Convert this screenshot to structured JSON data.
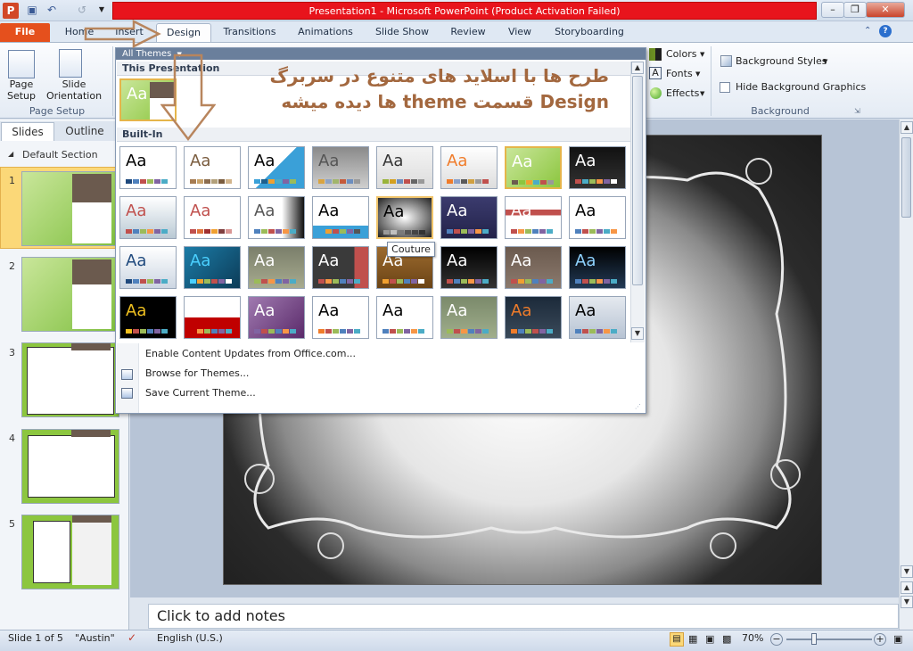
{
  "window": {
    "title": "Presentation1  -  Microsoft PowerPoint (Product Activation Failed)",
    "controls": [
      "–",
      "❐",
      "✕"
    ]
  },
  "tabs": [
    "Home",
    "Insert",
    "Design",
    "Transitions",
    "Animations",
    "Slide Show",
    "Review",
    "View",
    "Storyboarding"
  ],
  "file_tab": "File",
  "ribbon": {
    "page_setup": {
      "label": "Page\nSetup",
      "page_setup_1": "Page",
      "page_setup_2": "Setup",
      "orientation_1": "Slide",
      "orientation_2": "Orientation",
      "group": "Page Setup"
    },
    "theme_options": {
      "colors": "Colors",
      "fonts": "Fonts",
      "effects": "Effects"
    },
    "background": {
      "styles": "Background Styles",
      "hide": "Hide Background Graphics",
      "group": "Background"
    }
  },
  "themes_gallery": {
    "header": "All Themes",
    "this_presentation": "This Presentation",
    "built_in": "Built-In",
    "sample": "Aa",
    "tooltip": "Couture",
    "menu": [
      "Enable Content Updates from Office.com...",
      "Browse for Themes...",
      "Save Current Theme..."
    ]
  },
  "annotation": {
    "line1": "طرح ها با اسلاید های متنوع در سربرگ",
    "line2": "Design  قسمت theme ها دیده میشه"
  },
  "left_pane": {
    "tabs": [
      "Slides",
      "Outline"
    ],
    "section": "Default Section",
    "slide_numbers": [
      "1",
      "2",
      "3",
      "4",
      "5"
    ]
  },
  "notes": {
    "placeholder": "Click to add notes"
  },
  "status": {
    "slide": "Slide 1 of 5",
    "theme": "\"Austin\"",
    "language": "English (U.S.)",
    "zoom": "70%"
  },
  "colors": {
    "accent_file": "#e5501d",
    "title_red": "#e8141c",
    "annotation": "#a3683f",
    "austin_green": "#9acd32"
  }
}
